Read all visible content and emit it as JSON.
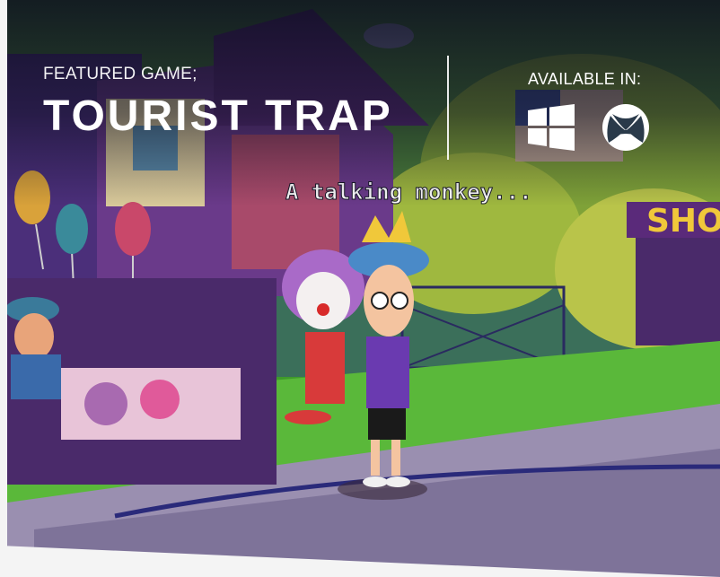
{
  "hero": {
    "featured_label": "FEATURED GAME;",
    "title": "TOURIST TRAP",
    "speech_text": "A talking monkey...",
    "shop_sign": "SHO"
  },
  "availability": {
    "label": "AVAILABLE IN:",
    "platforms": [
      {
        "name": "Windows",
        "icon": "windows-icon"
      },
      {
        "name": "Xbox",
        "icon": "xbox-icon"
      }
    ]
  },
  "colors": {
    "title_text": "#ffffff",
    "sky_dark": "#0a0c1e",
    "grass": "#3f9a2a",
    "path": "#9a8fb0"
  }
}
